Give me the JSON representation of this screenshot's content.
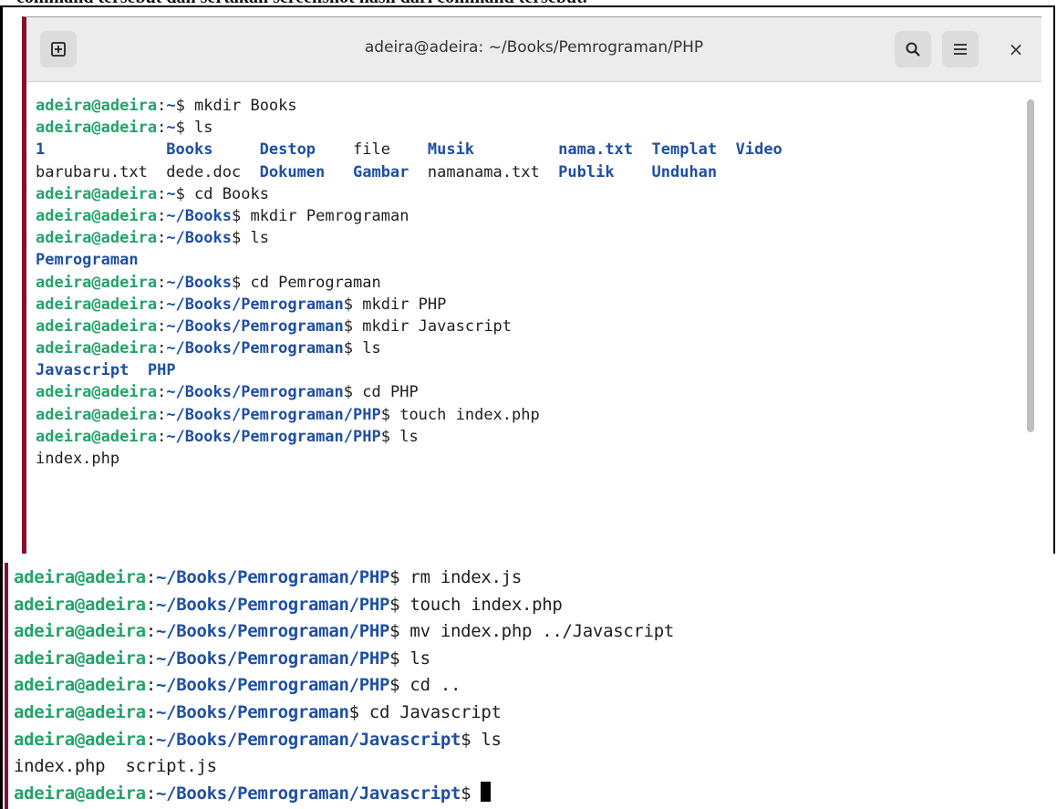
{
  "document": {
    "caption": "command tersebut dan sertakan screenshot hasil dari command tersebut."
  },
  "window": {
    "title": "adeira@adeira: ~/Books/Pemrograman/PHP",
    "buttons": {
      "new_tab": "new-tab-icon",
      "search": "search-icon",
      "menu": "menu-icon",
      "close": "×"
    }
  },
  "terminal1": {
    "lines": [
      {
        "kind": "prompt",
        "user": "adeira@adeira",
        "path": "~",
        "cmd": " mkdir Books"
      },
      {
        "kind": "prompt",
        "user": "adeira@adeira",
        "path": "~",
        "cmd": " ls"
      },
      {
        "kind": "ls",
        "items": [
          {
            "t": "1",
            "d": true
          },
          {
            "t": "Books",
            "d": true
          },
          {
            "t": "Destop",
            "d": true
          },
          {
            "t": "file",
            "d": false
          },
          {
            "t": "Musik",
            "d": true
          },
          {
            "t": "nama.txt",
            "d": true
          },
          {
            "t": "Templat",
            "d": true
          },
          {
            "t": "Video",
            "d": true
          }
        ]
      },
      {
        "kind": "ls",
        "items": [
          {
            "t": "barubaru.txt",
            "d": false
          },
          {
            "t": "dede.doc",
            "d": false
          },
          {
            "t": "Dokumen",
            "d": true
          },
          {
            "t": "Gambar",
            "d": true
          },
          {
            "t": "namanama.txt",
            "d": false
          },
          {
            "t": "Publik",
            "d": true
          },
          {
            "t": "Unduhan",
            "d": true
          }
        ]
      },
      {
        "kind": "prompt",
        "user": "adeira@adeira",
        "path": "~",
        "cmd": " cd Books"
      },
      {
        "kind": "prompt",
        "user": "adeira@adeira",
        "path": "~/Books",
        "cmd": " mkdir Pemrograman"
      },
      {
        "kind": "prompt",
        "user": "adeira@adeira",
        "path": "~/Books",
        "cmd": " ls"
      },
      {
        "kind": "ls",
        "items": [
          {
            "t": "Pemrograman",
            "d": true
          }
        ]
      },
      {
        "kind": "prompt",
        "user": "adeira@adeira",
        "path": "~/Books",
        "cmd": " cd Pemrograman"
      },
      {
        "kind": "prompt",
        "user": "adeira@adeira",
        "path": "~/Books/Pemrograman",
        "cmd": " mkdir PHP"
      },
      {
        "kind": "prompt",
        "user": "adeira@adeira",
        "path": "~/Books/Pemrograman",
        "cmd": " mkdir Javascript"
      },
      {
        "kind": "prompt",
        "user": "adeira@adeira",
        "path": "~/Books/Pemrograman",
        "cmd": " ls"
      },
      {
        "kind": "ls",
        "items": [
          {
            "t": "Javascript",
            "d": true
          },
          {
            "t": "PHP",
            "d": true
          }
        ]
      },
      {
        "kind": "prompt",
        "user": "adeira@adeira",
        "path": "~/Books/Pemrograman",
        "cmd": " cd PHP"
      },
      {
        "kind": "prompt",
        "user": "adeira@adeira",
        "path": "~/Books/Pemrograman/PHP",
        "cmd": " touch index.php"
      },
      {
        "kind": "prompt",
        "user": "adeira@adeira",
        "path": "~/Books/Pemrograman/PHP",
        "cmd": " ls"
      },
      {
        "kind": "text",
        "text": "index.php"
      }
    ]
  },
  "terminal2": {
    "lines": [
      {
        "kind": "prompt",
        "user": "adeira@adeira",
        "path": "~/Books/Pemrograman/PHP",
        "cmd": " rm index.js"
      },
      {
        "kind": "prompt",
        "user": "adeira@adeira",
        "path": "~/Books/Pemrograman/PHP",
        "cmd": " touch index.php"
      },
      {
        "kind": "prompt",
        "user": "adeira@adeira",
        "path": "~/Books/Pemrograman/PHP",
        "cmd": " mv index.php ../Javascript"
      },
      {
        "kind": "prompt",
        "user": "adeira@adeira",
        "path": "~/Books/Pemrograman/PHP",
        "cmd": " ls"
      },
      {
        "kind": "prompt",
        "user": "adeira@adeira",
        "path": "~/Books/Pemrograman/PHP",
        "cmd": " cd .."
      },
      {
        "kind": "prompt",
        "user": "adeira@adeira",
        "path": "~/Books/Pemrograman",
        "cmd": " cd Javascript"
      },
      {
        "kind": "prompt",
        "user": "adeira@adeira",
        "path": "~/Books/Pemrograman/Javascript",
        "cmd": " ls"
      },
      {
        "kind": "text",
        "text": "index.php  script.js"
      },
      {
        "kind": "prompt",
        "user": "adeira@adeira",
        "path": "~/Books/Pemrograman/Javascript",
        "cmd": " ",
        "cursor": true
      }
    ]
  },
  "colors": {
    "user_host": "#23a36a",
    "path": "#1f4fa3",
    "directory": "#1f4fa3",
    "accent_border": "#8a0f2a"
  }
}
